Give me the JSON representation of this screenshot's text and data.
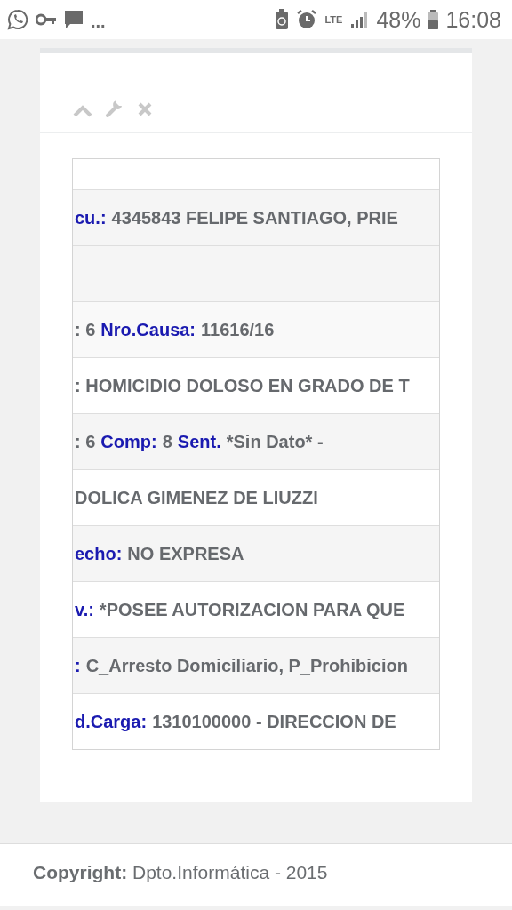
{
  "status_bar": {
    "overflow": "...",
    "network": "LTE",
    "battery": "48%",
    "time": "16:08"
  },
  "panel": {
    "rows": [
      {
        "segments": []
      },
      {
        "segments": [
          {
            "kind": "label",
            "text": "cu.:"
          },
          {
            "kind": "value",
            "text": "4345843 FELIPE SANTIAGO, PRIE"
          }
        ]
      },
      {
        "segments": []
      },
      {
        "segments": [
          {
            "kind": "value",
            "text": ": 6"
          },
          {
            "kind": "label",
            "text": "Nro.Causa:"
          },
          {
            "kind": "value",
            "text": "11616/16"
          }
        ]
      },
      {
        "segments": [
          {
            "kind": "value",
            "text": ": HOMICIDIO DOLOSO EN GRADO DE T"
          }
        ]
      },
      {
        "segments": [
          {
            "kind": "value",
            "text": ": 6"
          },
          {
            "kind": "label",
            "text": "Comp:"
          },
          {
            "kind": "value",
            "text": "8"
          },
          {
            "kind": "label",
            "text": "Sent."
          },
          {
            "kind": "value",
            "text": "*Sin Dato* -"
          }
        ]
      },
      {
        "segments": [
          {
            "kind": "value",
            "text": "DOLICA GIMENEZ DE LIUZZI"
          }
        ]
      },
      {
        "segments": [
          {
            "kind": "label",
            "text": "echo:"
          },
          {
            "kind": "value",
            "text": "NO EXPRESA"
          }
        ]
      },
      {
        "segments": [
          {
            "kind": "label",
            "text": "v.:"
          },
          {
            "kind": "value",
            "text": "*POSEE AUTORIZACION PARA QUE"
          }
        ]
      },
      {
        "segments": [
          {
            "kind": "label",
            "text": ":"
          },
          {
            "kind": "value",
            "text": "C_Arresto Domiciliario, P_Prohibicion"
          }
        ]
      },
      {
        "segments": [
          {
            "kind": "label",
            "text": "d.Carga:"
          },
          {
            "kind": "value",
            "text": "1310100000 - DIRECCION DE"
          }
        ]
      }
    ]
  },
  "footer": {
    "label": "Copyright:",
    "text": "Dpto.Informática - 2015"
  }
}
